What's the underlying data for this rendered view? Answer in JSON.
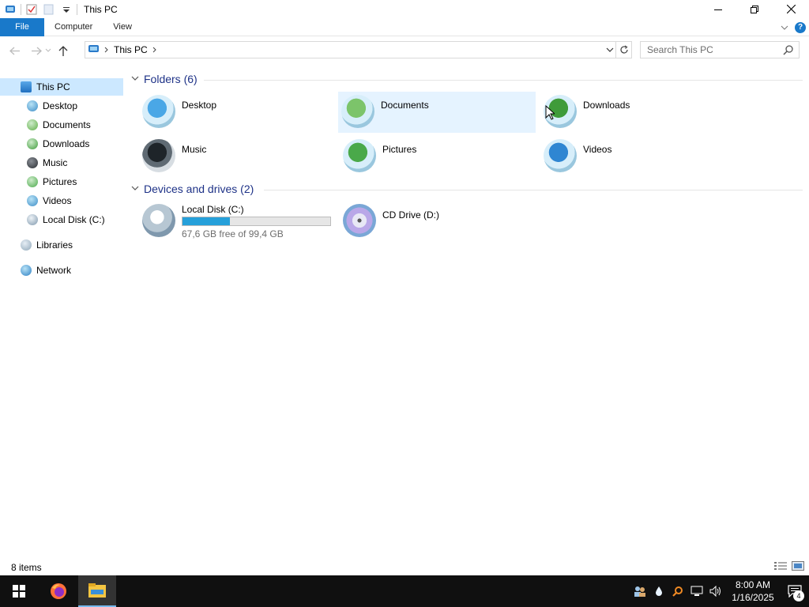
{
  "window": {
    "title": "This PC",
    "minimize_icon": "minimize-icon",
    "maximize_icon": "restore-icon",
    "close_icon": "close-icon"
  },
  "ribbon": {
    "tabs": [
      {
        "label": "File"
      },
      {
        "label": "Computer"
      },
      {
        "label": "View"
      }
    ]
  },
  "address": {
    "crumbs": [
      "This PC"
    ],
    "search_placeholder": "Search This PC"
  },
  "nav": {
    "items": [
      {
        "label": "This PC",
        "icon": "this-pc-icon"
      },
      {
        "label": "Desktop",
        "icon": "desktop-icon"
      },
      {
        "label": "Documents",
        "icon": "documents-icon"
      },
      {
        "label": "Downloads",
        "icon": "downloads-icon"
      },
      {
        "label": "Music",
        "icon": "music-icon"
      },
      {
        "label": "Pictures",
        "icon": "pictures-icon"
      },
      {
        "label": "Videos",
        "icon": "videos-icon"
      },
      {
        "label": "Local Disk (C:)",
        "icon": "local-disk-icon"
      },
      {
        "label": "Libraries",
        "icon": "libraries-icon"
      },
      {
        "label": "Network",
        "icon": "network-icon"
      }
    ]
  },
  "folders": {
    "header": "Folders (6)",
    "items": [
      {
        "label": "Desktop",
        "icon": "desktop-folder-icon"
      },
      {
        "label": "Documents",
        "icon": "documents-folder-icon"
      },
      {
        "label": "Downloads",
        "icon": "downloads-folder-icon"
      },
      {
        "label": "Music",
        "icon": "music-folder-icon"
      },
      {
        "label": "Pictures",
        "icon": "pictures-folder-icon"
      },
      {
        "label": "Videos",
        "icon": "videos-folder-icon"
      }
    ]
  },
  "drives": {
    "header": "Devices and drives (2)",
    "items": [
      {
        "label": "Local Disk (C:)",
        "free_text": "67,6 GB free of 99,4 GB",
        "used_fraction": 0.32,
        "icon": "hard-disk-icon"
      },
      {
        "label": "CD Drive (D:)",
        "icon": "cd-drive-icon"
      }
    ]
  },
  "status": {
    "items_text": "8 items"
  },
  "taskbar": {
    "time": "8:00 AM",
    "date": "1/16/2025",
    "notification_count": "4",
    "apps": [
      "firefox-icon",
      "file-explorer-icon"
    ]
  },
  "colors": {
    "accent": "#1979ca",
    "selection": "#cce8ff",
    "hover": "#e5f3ff",
    "drive_bar": "#26a0da",
    "group_header": "#1e3287"
  }
}
